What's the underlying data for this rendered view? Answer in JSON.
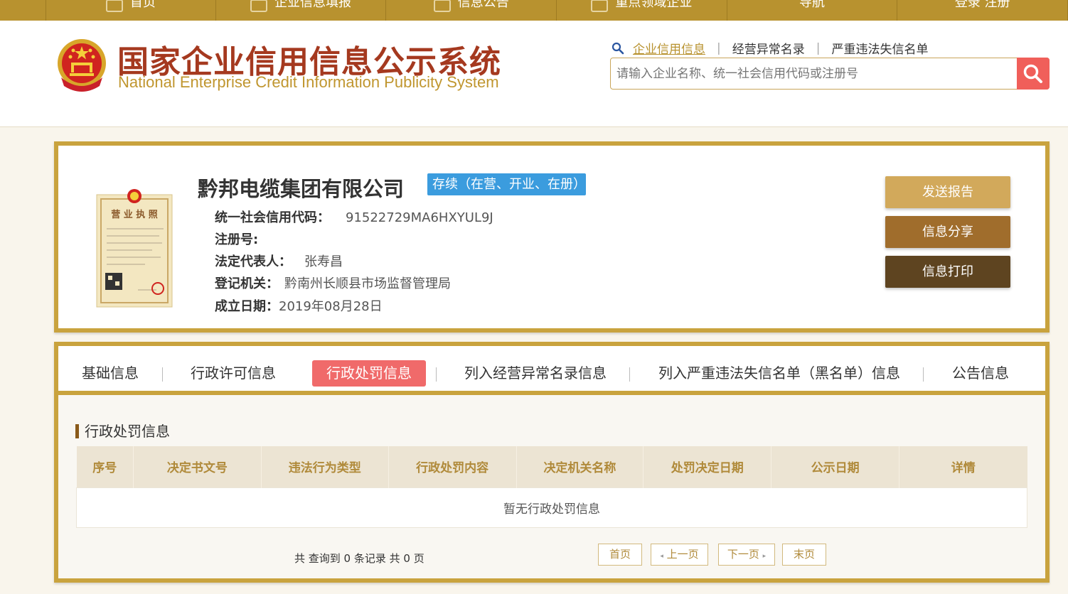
{
  "topnav": {
    "items": [
      {
        "label": "首页",
        "icon": "home-icon"
      },
      {
        "label": "企业信息填报",
        "icon": "edit-icon"
      },
      {
        "label": "信息公告",
        "icon": "notice-icon"
      },
      {
        "label": "重点领域企业",
        "icon": "megaphone-icon"
      },
      {
        "label": "导航",
        "icon": ""
      },
      {
        "label": "登录 注册",
        "icon": ""
      }
    ]
  },
  "header": {
    "title_cn": "国家企业信用信息公示系统",
    "title_en": "National Enterprise Credit Information Publicity System",
    "quick_links": [
      "企业信用信息",
      "经营异常名录",
      "严重违法失信名单"
    ],
    "search_placeholder": "请输入企业名称、统一社会信用代码或注册号"
  },
  "company": {
    "name": "黔邦电缆集团有限公司",
    "status": "存续（在营、开业、在册）",
    "license_title": "营业执照",
    "fields": [
      {
        "key": "统一社会信用代码：",
        "value": "91522729MA6HXYUL9J"
      },
      {
        "key": "注册号:",
        "value": ""
      },
      {
        "key": "法定代表人：",
        "value": "张寿昌"
      },
      {
        "key": "登记机关：",
        "value": "黔南州长顺县市场监督管理局"
      },
      {
        "key": "成立日期：",
        "value": "2019年08月28日"
      }
    ],
    "actions": [
      {
        "label": "发送报告",
        "color": "#d2a95b"
      },
      {
        "label": "信息分享",
        "color": "#a06d2c"
      },
      {
        "label": "信息打印",
        "color": "#5e4420"
      }
    ]
  },
  "tabs": {
    "items": [
      "基础信息",
      "行政许可信息",
      "行政处罚信息",
      "列入经营异常名录信息",
      "列入严重违法失信名单（黑名单）信息",
      "公告信息"
    ],
    "active": "行政处罚信息"
  },
  "section": {
    "title": "行政处罚信息",
    "columns": [
      "序号",
      "决定书文号",
      "违法行为类型",
      "行政处罚内容",
      "决定机关名称",
      "处罚决定日期",
      "公示日期",
      "详情"
    ],
    "empty_text": "暂无行政处罚信息"
  },
  "pager": {
    "summary": "共 查询到 0 条记录 共 0 页",
    "first": "首页",
    "prev": "上一页",
    "next": "下一页",
    "last": "末页"
  },
  "colors": {
    "gold": "#c9a33e",
    "brand_red": "#a5391f",
    "status_blue": "#3b9cde",
    "active_tab": "#f06a6a",
    "search_btn": "#f05f5a"
  }
}
